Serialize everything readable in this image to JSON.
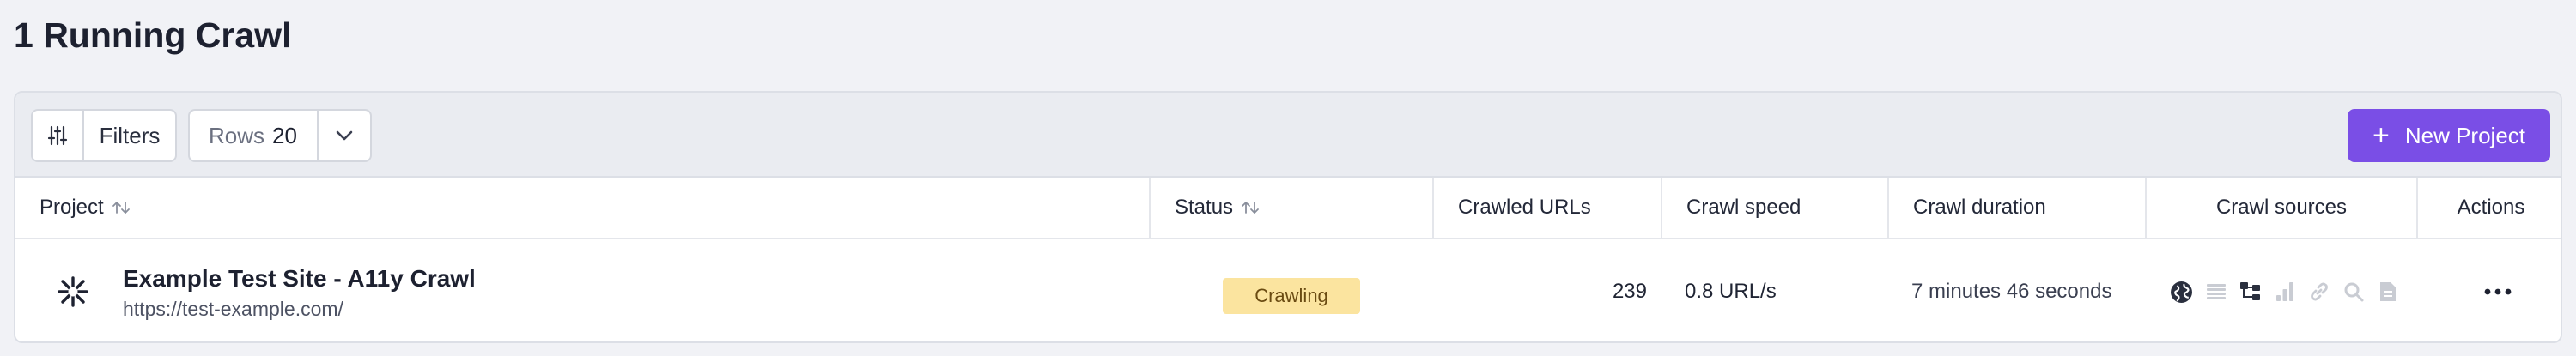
{
  "page": {
    "title": "1 Running Crawl"
  },
  "toolbar": {
    "filters_label": "Filters",
    "rows_label": "Rows",
    "rows_value": "20",
    "new_project_label": "New Project"
  },
  "table": {
    "columns": {
      "project": "Project",
      "status": "Status",
      "crawled_urls": "Crawled URLs",
      "crawl_speed": "Crawl speed",
      "crawl_duration": "Crawl duration",
      "crawl_sources": "Crawl sources",
      "actions": "Actions"
    },
    "rows": [
      {
        "project_name": "Example Test Site - A11y Crawl",
        "project_url": "https://test-example.com/",
        "status": "Crawling",
        "crawled_urls": "239",
        "crawl_speed": "0.8 URL/s",
        "crawl_duration": "7 minutes 46 seconds",
        "sources": [
          {
            "icon": "globe-icon",
            "active": true
          },
          {
            "icon": "list-icon",
            "active": false
          },
          {
            "icon": "sitemap-icon",
            "active": true
          },
          {
            "icon": "analytics-icon",
            "active": false
          },
          {
            "icon": "link-icon",
            "active": false
          },
          {
            "icon": "search-icon",
            "active": false
          },
          {
            "icon": "file-icon",
            "active": false
          }
        ]
      }
    ]
  },
  "colors": {
    "accent": "#7a4ee6",
    "badge_bg": "#fbe49f",
    "badge_text": "#6a4b12",
    "active_icon": "#2a2f3e",
    "inactive_icon": "#c9ccd3"
  }
}
